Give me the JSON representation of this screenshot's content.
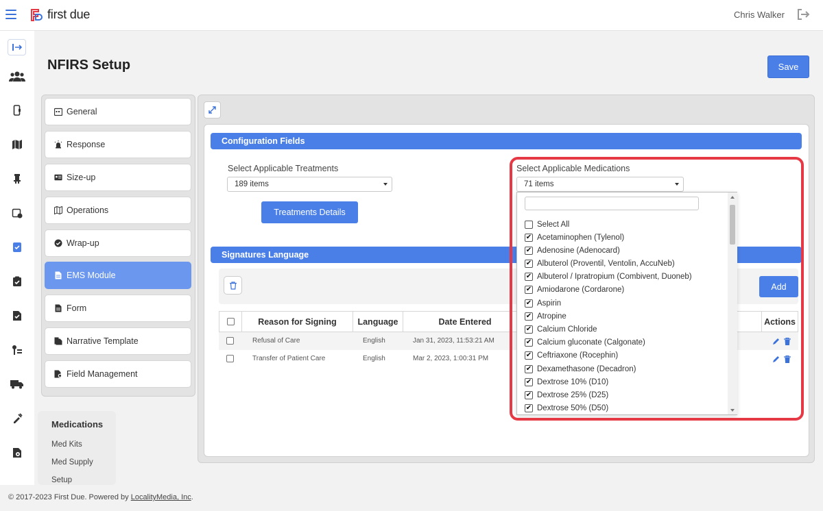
{
  "header": {
    "brand": "first due",
    "user_name": "Chris Walker",
    "brand_color": "#e63946",
    "accent_color": "#4a7fe8"
  },
  "page": {
    "title": "NFIRS Setup",
    "save_label": "Save"
  },
  "sidebar_menu": [
    {
      "label": "General",
      "icon": "calendar-icon"
    },
    {
      "label": "Response",
      "icon": "siren-icon"
    },
    {
      "label": "Size-up",
      "icon": "id-card-icon"
    },
    {
      "label": "Operations",
      "icon": "map-icon"
    },
    {
      "label": "Wrap-up",
      "icon": "check-circle-icon"
    },
    {
      "label": "EMS Module",
      "icon": "document-icon",
      "active": true
    },
    {
      "label": "Form",
      "icon": "document-icon"
    },
    {
      "label": "Narrative Template",
      "icon": "documents-icon"
    },
    {
      "label": "Field Management",
      "icon": "document-gear-icon"
    }
  ],
  "medications_submenu": {
    "heading": "Medications",
    "items": [
      "Med Kits",
      "Med Supply",
      "Setup"
    ]
  },
  "config": {
    "section_title": "Configuration Fields",
    "treatments_label": "Select Applicable Treatments",
    "treatments_value": "189 items",
    "treatments_button": "Treatments Details",
    "medications_label": "Select Applicable Medications",
    "medications_value": "71 items"
  },
  "signatures": {
    "section_title": "Signatures Language",
    "add_label": "Add",
    "columns": [
      "Reason for Signing",
      "Language",
      "Date Entered",
      "Actions"
    ],
    "rows": [
      {
        "reason": "Refusal of Care",
        "language": "English",
        "date": "Jan 31, 2023, 11:53:21 AM"
      },
      {
        "reason": "Transfer of Patient Care",
        "language": "English",
        "date": "Mar 2, 2023, 1:00:31 PM"
      }
    ]
  },
  "medications_dropdown": {
    "select_all": "Select All",
    "options": [
      "Acetaminophen (Tylenol)",
      "Adenosine (Adenocard)",
      "Albuterol (Proventil, Ventolin, AccuNeb)",
      "Albuterol / Ipratropium (Combivent, Duoneb)",
      "Amiodarone (Cordarone)",
      "Aspirin",
      "Atropine",
      "Calcium Chloride",
      "Calcium gluconate (Calgonate)",
      "Ceftriaxone (Rocephin)",
      "Dexamethasone (Decadron)",
      "Dextrose 10% (D10)",
      "Dextrose 25% (D25)",
      "Dextrose 50% (D50)"
    ]
  },
  "footer": {
    "copyright": "© 2017-2023 First Due. Powered by ",
    "link": "LocalityMedia, Inc",
    "suffix": "."
  }
}
